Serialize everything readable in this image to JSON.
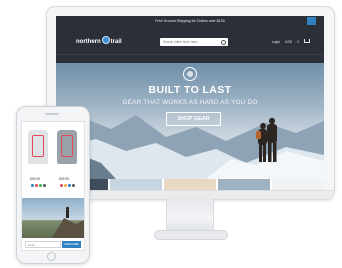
{
  "promo": {
    "text": "Free Ground Shipping for Orders over $100"
  },
  "header": {
    "logo_left": "northern",
    "logo_right": "trail",
    "search_placeholder": "Search entire store here...",
    "login": "Login",
    "currency": "USD",
    "cart_count": "0"
  },
  "nav": {
    "items": [
      "New Arrivals",
      "Womens",
      "Mens",
      "Top Sellers"
    ]
  },
  "hero": {
    "title": "BUILT TO LAST",
    "subtitle": "GEAR THAT WORKS AS HARD AS YOU DO",
    "cta": "SHOP GEAR"
  },
  "phone": {
    "products": [
      {
        "price": "$99.99"
      },
      {
        "price": "$99.99"
      }
    ],
    "email_placeholder": "Email",
    "subscribe": "SUBSCRIBE"
  },
  "colors": {
    "accent": "#2f7fc1",
    "header_bg": "#2a2f38"
  }
}
